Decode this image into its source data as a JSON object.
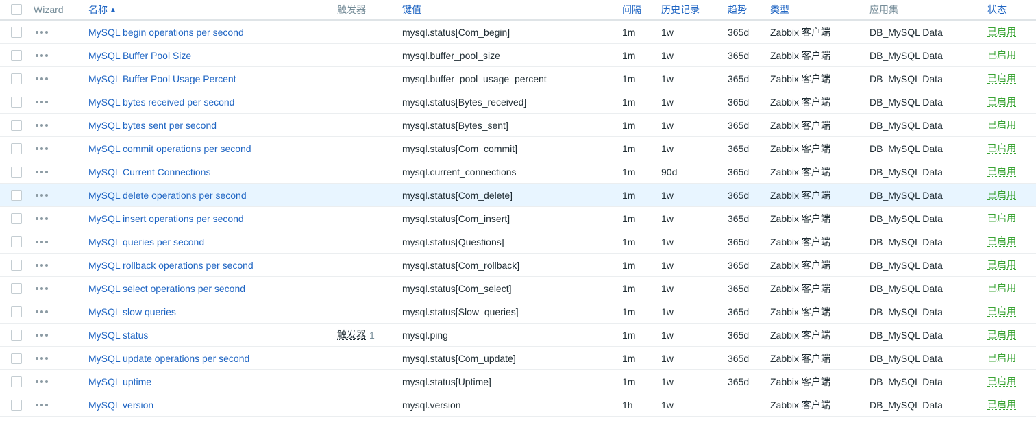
{
  "header": {
    "wizard": "Wizard",
    "name": "名称",
    "sort_indicator": "▲",
    "triggers": "触发器",
    "key": "键值",
    "interval": "间隔",
    "history": "历史记录",
    "trends": "趋势",
    "type": "类型",
    "application": "应用集",
    "status": "状态"
  },
  "rows": [
    {
      "name": "MySQL begin operations per second",
      "triggers": "",
      "trigger_count": "",
      "key": "mysql.status[Com_begin]",
      "interval": "1m",
      "history": "1w",
      "trends": "365d",
      "type": "Zabbix 客户端",
      "application": "DB_MySQL Data",
      "status": "已启用"
    },
    {
      "name": "MySQL Buffer Pool Size",
      "triggers": "",
      "trigger_count": "",
      "key": "mysql.buffer_pool_size",
      "interval": "1m",
      "history": "1w",
      "trends": "365d",
      "type": "Zabbix 客户端",
      "application": "DB_MySQL Data",
      "status": "已启用"
    },
    {
      "name": "MySQL Buffer Pool Usage Percent",
      "triggers": "",
      "trigger_count": "",
      "key": "mysql.buffer_pool_usage_percent",
      "interval": "1m",
      "history": "1w",
      "trends": "365d",
      "type": "Zabbix 客户端",
      "application": "DB_MySQL Data",
      "status": "已启用"
    },
    {
      "name": "MySQL bytes received per second",
      "triggers": "",
      "trigger_count": "",
      "key": "mysql.status[Bytes_received]",
      "interval": "1m",
      "history": "1w",
      "trends": "365d",
      "type": "Zabbix 客户端",
      "application": "DB_MySQL Data",
      "status": "已启用"
    },
    {
      "name": "MySQL bytes sent per second",
      "triggers": "",
      "trigger_count": "",
      "key": "mysql.status[Bytes_sent]",
      "interval": "1m",
      "history": "1w",
      "trends": "365d",
      "type": "Zabbix 客户端",
      "application": "DB_MySQL Data",
      "status": "已启用"
    },
    {
      "name": "MySQL commit operations per second",
      "triggers": "",
      "trigger_count": "",
      "key": "mysql.status[Com_commit]",
      "interval": "1m",
      "history": "1w",
      "trends": "365d",
      "type": "Zabbix 客户端",
      "application": "DB_MySQL Data",
      "status": "已启用"
    },
    {
      "name": "MySQL Current Connections",
      "triggers": "",
      "trigger_count": "",
      "key": "mysql.current_connections",
      "interval": "1m",
      "history": "90d",
      "trends": "365d",
      "type": "Zabbix 客户端",
      "application": "DB_MySQL Data",
      "status": "已启用"
    },
    {
      "name": "MySQL delete operations per second",
      "triggers": "",
      "trigger_count": "",
      "key": "mysql.status[Com_delete]",
      "interval": "1m",
      "history": "1w",
      "trends": "365d",
      "type": "Zabbix 客户端",
      "application": "DB_MySQL Data",
      "status": "已启用"
    },
    {
      "name": "MySQL insert operations per second",
      "triggers": "",
      "trigger_count": "",
      "key": "mysql.status[Com_insert]",
      "interval": "1m",
      "history": "1w",
      "trends": "365d",
      "type": "Zabbix 客户端",
      "application": "DB_MySQL Data",
      "status": "已启用"
    },
    {
      "name": "MySQL queries per second",
      "triggers": "",
      "trigger_count": "",
      "key": "mysql.status[Questions]",
      "interval": "1m",
      "history": "1w",
      "trends": "365d",
      "type": "Zabbix 客户端",
      "application": "DB_MySQL Data",
      "status": "已启用"
    },
    {
      "name": "MySQL rollback operations per second",
      "triggers": "",
      "trigger_count": "",
      "key": "mysql.status[Com_rollback]",
      "interval": "1m",
      "history": "1w",
      "trends": "365d",
      "type": "Zabbix 客户端",
      "application": "DB_MySQL Data",
      "status": "已启用"
    },
    {
      "name": "MySQL select operations per second",
      "triggers": "",
      "trigger_count": "",
      "key": "mysql.status[Com_select]",
      "interval": "1m",
      "history": "1w",
      "trends": "365d",
      "type": "Zabbix 客户端",
      "application": "DB_MySQL Data",
      "status": "已启用"
    },
    {
      "name": "MySQL slow queries",
      "triggers": "",
      "trigger_count": "",
      "key": "mysql.status[Slow_queries]",
      "interval": "1m",
      "history": "1w",
      "trends": "365d",
      "type": "Zabbix 客户端",
      "application": "DB_MySQL Data",
      "status": "已启用"
    },
    {
      "name": "MySQL status",
      "triggers": "触发器",
      "trigger_count": "1",
      "key": "mysql.ping",
      "interval": "1m",
      "history": "1w",
      "trends": "365d",
      "type": "Zabbix 客户端",
      "application": "DB_MySQL Data",
      "status": "已启用"
    },
    {
      "name": "MySQL update operations per second",
      "triggers": "",
      "trigger_count": "",
      "key": "mysql.status[Com_update]",
      "interval": "1m",
      "history": "1w",
      "trends": "365d",
      "type": "Zabbix 客户端",
      "application": "DB_MySQL Data",
      "status": "已启用"
    },
    {
      "name": "MySQL uptime",
      "triggers": "",
      "trigger_count": "",
      "key": "mysql.status[Uptime]",
      "interval": "1m",
      "history": "1w",
      "trends": "365d",
      "type": "Zabbix 客户端",
      "application": "DB_MySQL Data",
      "status": "已启用"
    },
    {
      "name": "MySQL version",
      "triggers": "",
      "trigger_count": "",
      "key": "mysql.version",
      "interval": "1h",
      "history": "1w",
      "trends": "",
      "type": "Zabbix 客户端",
      "application": "DB_MySQL Data",
      "status": "已启用"
    }
  ],
  "highlighted_row_index": 7
}
